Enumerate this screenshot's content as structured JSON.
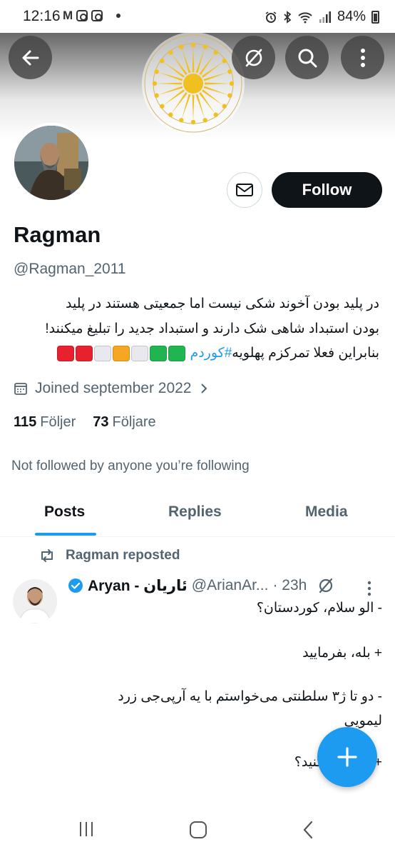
{
  "status_bar": {
    "time": "12:16",
    "left_icons": [
      "gmail-icon",
      "instagram-icon",
      "instagram-icon",
      "dot-icon"
    ],
    "right_icons": [
      "alarm-icon",
      "bluetooth-icon",
      "wifi-icon",
      "signal-icon"
    ],
    "battery_text": "84%"
  },
  "header": {
    "back_icon": "arrow-left-icon",
    "action_icons": [
      "grok-icon",
      "search-icon",
      "more-vertical-icon"
    ]
  },
  "profile": {
    "name": "Ragman",
    "handle": "@Ragman_2011",
    "bio_line1": "در پلید بودن آخوند شکی نیست اما جمعیتی هستند  در پلید",
    "bio_line2": "بودن استبداد شاهی شک دارند و استبداد جدید را تبلیغ میکنند!",
    "bio_line3_text": "بنابراین فعلا تمرکزم پهلویه ",
    "bio_hashtag": "#کوردم",
    "joined": "Joined september 2022",
    "following_count": "115",
    "following_label": "Följer",
    "followers_count": "73",
    "followers_label": "Följare",
    "not_followed_text": "Not followed by anyone you’re following",
    "follow_label": "Follow",
    "flag_squares": [
      "#e8212e",
      "#e8212e",
      "#e8e8ee",
      "#f5a623",
      "#e8e8ee",
      "#21b552",
      "#21b552"
    ]
  },
  "tabs": [
    {
      "label": "Posts",
      "active": true
    },
    {
      "label": "Replies",
      "active": false
    },
    {
      "label": "Media",
      "active": false
    }
  ],
  "post": {
    "repost_label": "Ragman reposted",
    "author_name": "Aryan - ئاریان",
    "author_handle": "@ArianAr...",
    "time": "· 23h",
    "lines": [
      "- الو سلام، کوردستان؟",
      "+ بله، بفرمایید",
      "- دو تا ژ۳ سلطنتی می‌خواستم با یه آرپی‌جی زرد",
      "لیمویی",
      "+ ... ل می‌کنید؟"
    ]
  },
  "colors": {
    "accent": "#1d9bf0",
    "text_primary": "#0f1419",
    "text_secondary": "#536471",
    "follow_bg": "#0f1419",
    "emblem_yellow": "#f0c020"
  },
  "nav_bar": {
    "icons": [
      "recents-icon",
      "home-icon",
      "back-icon"
    ]
  }
}
